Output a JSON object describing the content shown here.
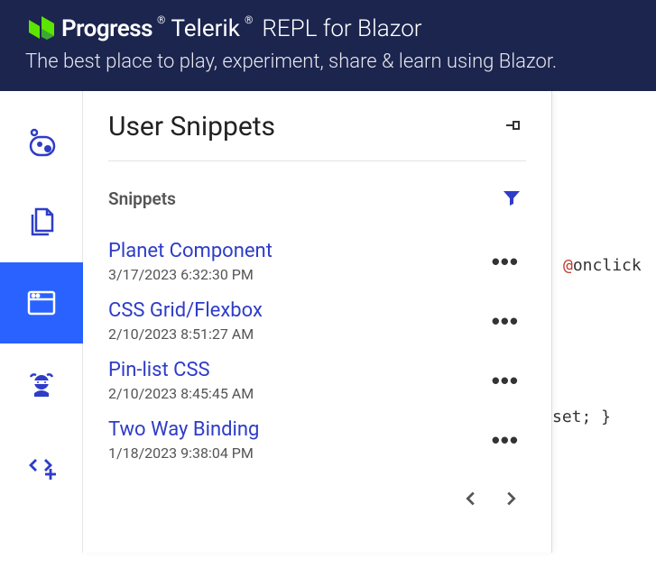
{
  "header": {
    "brand_progress": "Progress",
    "brand_telerik": "Telerik",
    "brand_sub": "REPL for Blazor",
    "tagline": "The best place to play, experiment, share & learn using Blazor."
  },
  "panel": {
    "title": "User Snippets",
    "section_title": "Snippets"
  },
  "snippets": [
    {
      "name": "Planet Component",
      "date": "3/17/2023 6:32:30 PM"
    },
    {
      "name": "CSS Grid/Flexbox",
      "date": "2/10/2023 8:51:27 AM"
    },
    {
      "name": "Pin-list CSS",
      "date": "2/10/2023 8:45:45 AM"
    },
    {
      "name": "Two Way Binding",
      "date": "1/18/2023 9:38:04 PM"
    }
  ],
  "code": {
    "fragment1_at": "@",
    "fragment1_txt": "onclick",
    "fragment2": "set; }"
  }
}
